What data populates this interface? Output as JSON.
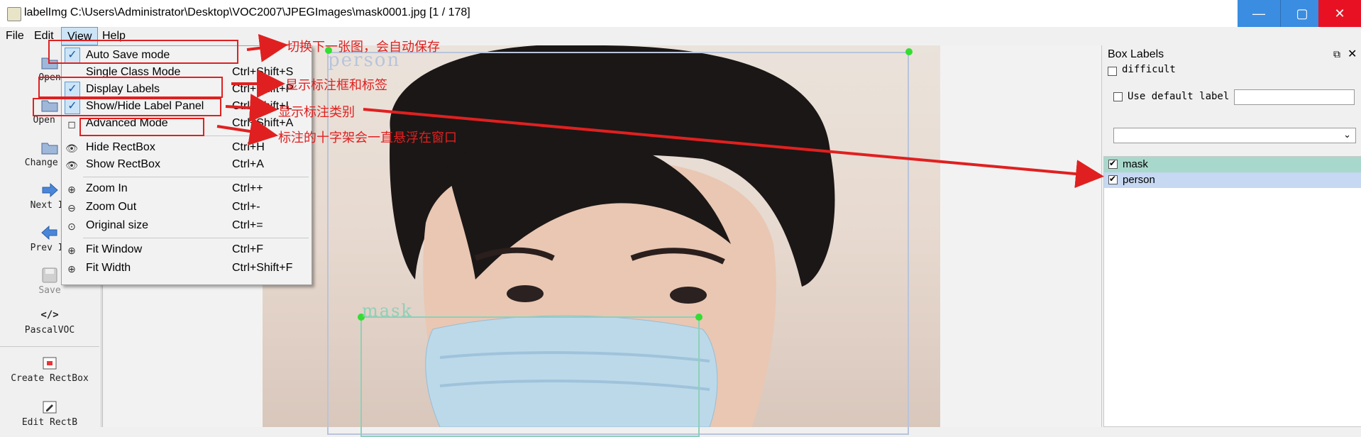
{
  "window": {
    "title": "labelImg C:\\Users\\Administrator\\Desktop\\VOC2007\\JPEGImages\\mask0001.jpg [1 / 178]",
    "minimize_glyph": "—",
    "maximize_glyph": "▢",
    "close_glyph": "✕"
  },
  "menubar": {
    "file": "File",
    "edit": "Edit",
    "view": "View",
    "help": "Help"
  },
  "toolbar": {
    "open": "Open",
    "open_dir": "Open D",
    "change_save": "Change Sa",
    "next_image": "Next Im",
    "prev_image": "Prev Im",
    "save": "Save",
    "format_icon_text": "</>",
    "format": "PascalVOC",
    "create_rectbox": "Create RectBox",
    "edit_rectbox": "Edit RectB"
  },
  "view_menu": {
    "auto_save": {
      "label": "Auto Save mode",
      "checked": true
    },
    "single_class": {
      "label": "Single Class Mode",
      "shortcut": "Ctrl+Shift+S"
    },
    "display_labels": {
      "label": "Display Labels",
      "shortcut": "Ctrl+Shift+P",
      "checked": true
    },
    "label_panel": {
      "label": "Show/Hide Label Panel",
      "shortcut": "Ctrl+Shift+L",
      "checked": true
    },
    "advanced_mode": {
      "label": "Advanced Mode",
      "shortcut": "Ctrl+Shift+A"
    },
    "hide_rectbox": {
      "label": "Hide RectBox",
      "shortcut": "Ctrl+H"
    },
    "show_rectbox": {
      "label": "Show RectBox",
      "shortcut": "Ctrl+A"
    },
    "zoom_in": {
      "label": "Zoom In",
      "shortcut": "Ctrl++"
    },
    "zoom_out": {
      "label": "Zoom Out",
      "shortcut": "Ctrl+-"
    },
    "original_size": {
      "label": "Original size",
      "shortcut": "Ctrl+="
    },
    "fit_window": {
      "label": "Fit Window",
      "shortcut": "Ctrl+F"
    },
    "fit_width": {
      "label": "Fit Width",
      "shortcut": "Ctrl+Shift+F"
    }
  },
  "canvas": {
    "box_person_label": "person",
    "box_mask_label": "mask"
  },
  "panel": {
    "title": "Box Labels",
    "difficult": "difficult",
    "use_default_label": "Use default label",
    "default_label_value": "",
    "dropdown_value": "",
    "labels": [
      {
        "name": "mask",
        "checked": true,
        "color": "#a8d8cc"
      },
      {
        "name": "person",
        "checked": true,
        "color": "#c6d8f2"
      }
    ]
  },
  "annotations": {
    "auto_save_note": "切换下一张图，会自动保存",
    "display_labels_note": "显示标注框和标签",
    "label_panel_note": "显示标注类别",
    "advanced_mode_note": "标注的十字架会一直悬浮在窗口"
  },
  "colors": {
    "annotation_red": "#e02020",
    "person_box": "#b8c4dc",
    "mask_box": "#8ed0b8",
    "vertex": "#33dd33"
  }
}
